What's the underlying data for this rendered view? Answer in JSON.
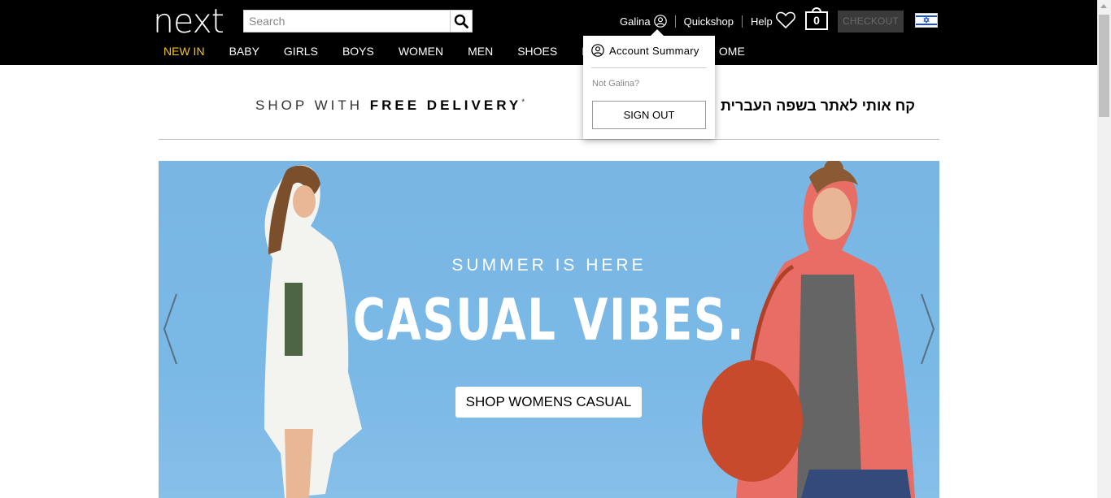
{
  "header": {
    "logo": "next",
    "search_placeholder": "Search",
    "user_name": "Galina",
    "quickshop": "Quickshop",
    "help": "Help",
    "bag_count": "0",
    "checkout": "CHECKOUT",
    "nav": [
      "NEW IN",
      "BABY",
      "GIRLS",
      "BOYS",
      "WOMEN",
      "MEN",
      "SHOES",
      "BE",
      "",
      "OME"
    ]
  },
  "account_dropdown": {
    "summary": "Account Summary",
    "not_user": "Not Galina?",
    "sign_out": "SIGN OUT"
  },
  "delivery": {
    "prefix": "SHOP WITH ",
    "bold": "FREE DELIVERY",
    "suffix": "*",
    "hebrew": "קח אותי לאתר בשפה העברית"
  },
  "banner": {
    "subtitle": "SUMMER IS HERE",
    "title": "CASUAL VIBES.",
    "cta": "SHOP WOMENS CASUAL"
  },
  "colors": {
    "header_bg": "#000000",
    "active_nav": "#f5c518",
    "banner_bg": "#7ab8e6"
  }
}
